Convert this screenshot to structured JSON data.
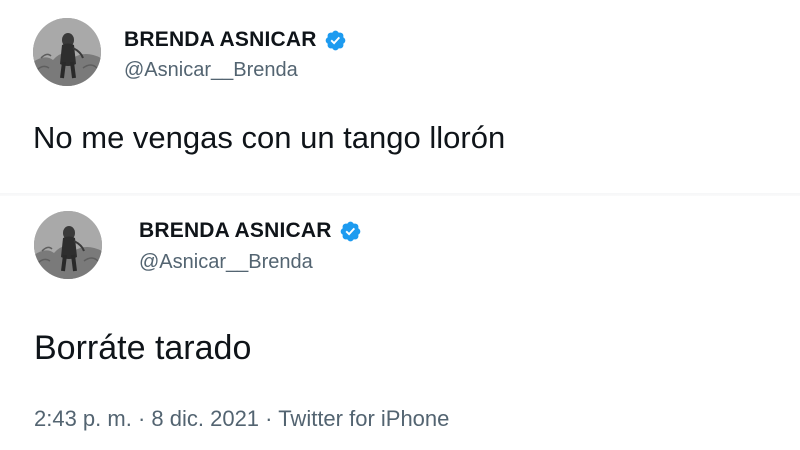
{
  "tweets": [
    {
      "author": {
        "display_name": "BRENDA ASNICAR",
        "handle": "@Asnicar__Brenda",
        "verified_icon": "verified-badge-icon"
      },
      "text": "No me vengas con un tango llorón"
    },
    {
      "author": {
        "display_name": "BRENDA ASNICAR",
        "handle": "@Asnicar__Brenda",
        "verified_icon": "verified-badge-icon"
      },
      "text": "Borráte tarado",
      "meta": {
        "time": "2:43 p. m.",
        "separator1": " · ",
        "date": "8 dic. 2021",
        "separator2": " · ",
        "source": "Twitter for iPhone"
      }
    }
  ],
  "colors": {
    "verified_blue": "#1d9bf0",
    "secondary_text": "#536471",
    "primary_text": "#0f1419"
  }
}
